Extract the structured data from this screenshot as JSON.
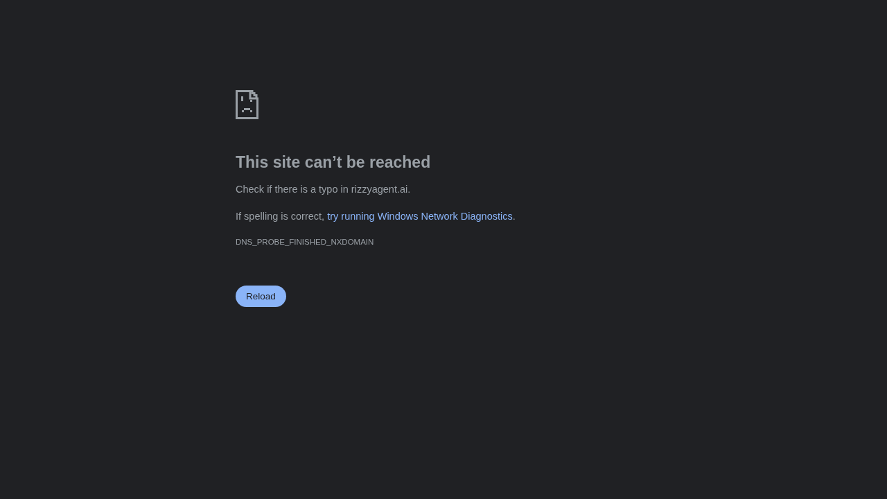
{
  "heading": "This site can’t be reached",
  "hint": "Check if there is a typo in rizzyagent.ai.",
  "suggestion": {
    "prefix": "If spelling is correct, ",
    "link": "try running Windows Network Diagnostics",
    "suffix": "."
  },
  "error_code": "DNS_PROBE_FINISHED_NXDOMAIN",
  "buttons": [
    {
      "label": "Reload"
    }
  ]
}
